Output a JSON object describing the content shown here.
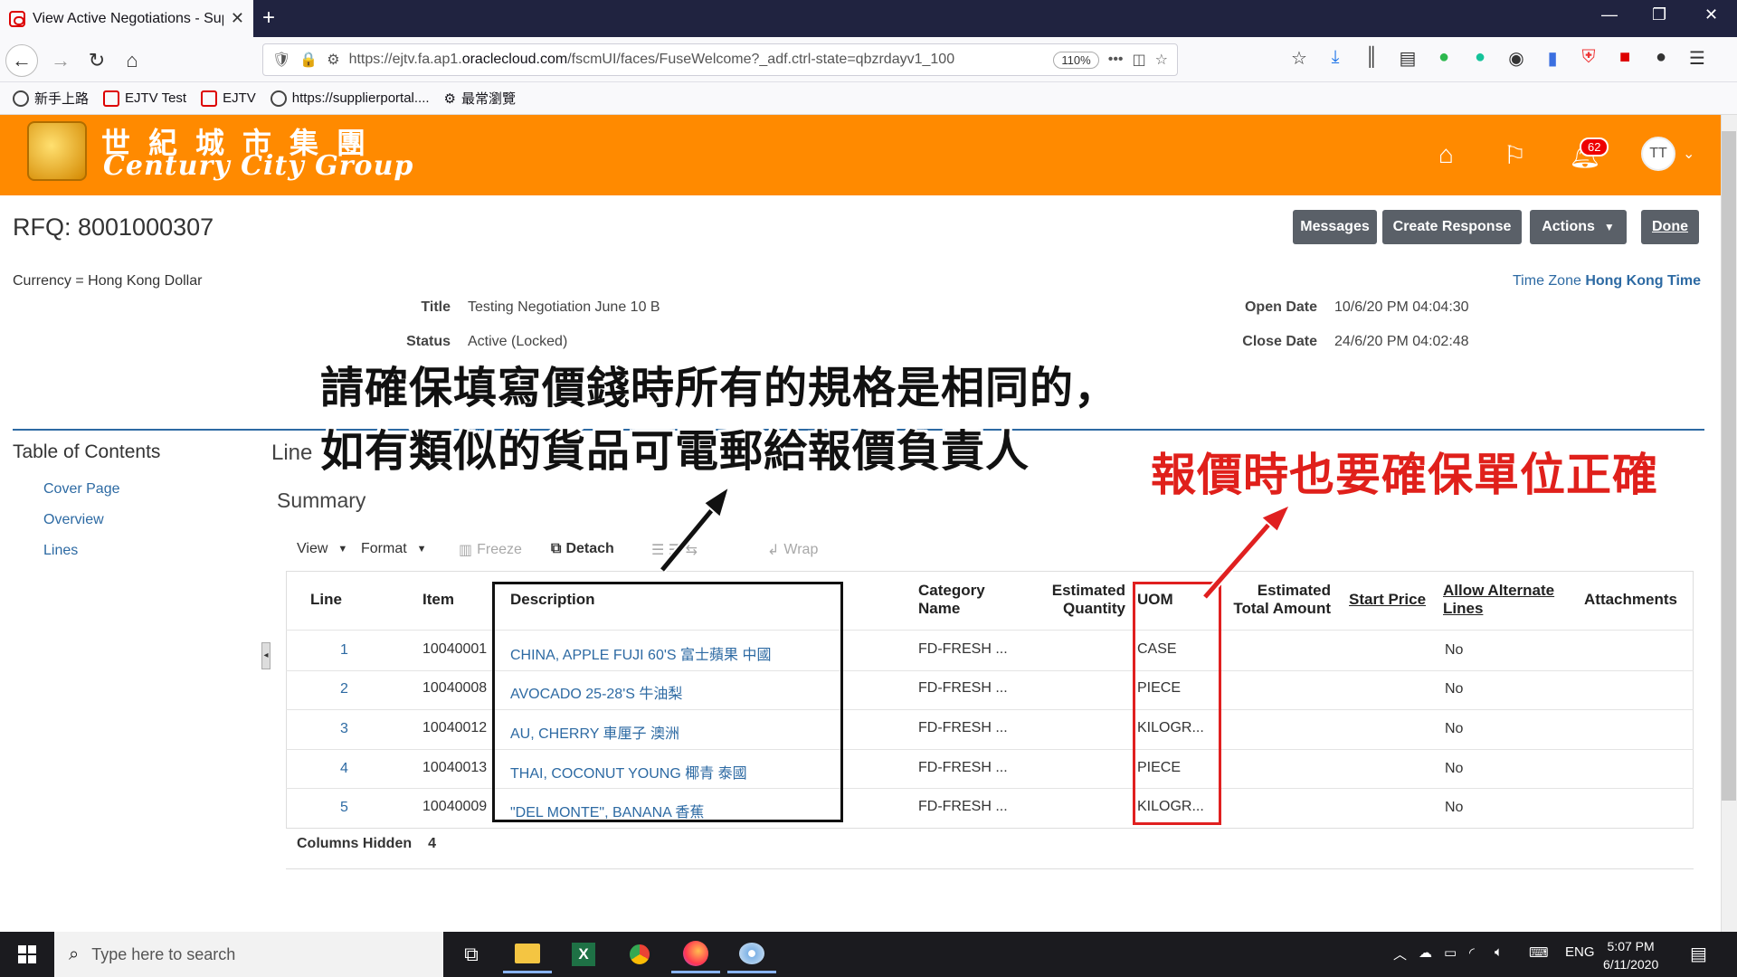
{
  "browser": {
    "tab_title": "View Active Negotiations - Sup",
    "url_prefix": "https://ejtv.fa.ap1.",
    "url_domain": "oraclecloud.com",
    "url_rest": "/fscmUI/faces/FuseWelcome?_adf.ctrl-state=qbzrdayv1_100",
    "zoom": "110%",
    "bookmarks": [
      "新手上路",
      "EJTV Test",
      "EJTV",
      "https://supplierportal....",
      "最常瀏覽"
    ]
  },
  "header": {
    "logo_cn": "世紀城市集團",
    "logo_en": "Century City Group",
    "notification_count": "62",
    "user_initials": "TT"
  },
  "page": {
    "rfq_title": "RFQ: 8001000307",
    "buttons": {
      "messages": "Messages",
      "create_response": "Create Response",
      "actions": "Actions",
      "done": "Done"
    },
    "currency": "Currency = Hong Kong Dollar",
    "timezone_label": "Time Zone",
    "timezone_value": "Hong Kong Time",
    "fields": {
      "title_label": "Title",
      "title_value": "Testing Negotiation June 10 B",
      "status_label": "Status",
      "status_value": "Active (Locked)",
      "open_label": "Open Date",
      "open_value": "10/6/20 PM 04:04:30",
      "close_label": "Close Date",
      "close_value": "24/6/20 PM 04:02:48"
    }
  },
  "toc": {
    "title": "Table of Contents",
    "links": [
      "Cover Page",
      "Overview",
      "Lines"
    ]
  },
  "lines": {
    "section_title": "Line",
    "summary_title": "Summary",
    "toolbar": {
      "view": "View",
      "format": "Format",
      "freeze": "Freeze",
      "detach": "Detach",
      "wrap": "Wrap"
    },
    "columns": {
      "line": "Line",
      "item": "Item",
      "description": "Description",
      "category_1": "Category",
      "category_2": "Name",
      "est_qty_1": "Estimated",
      "est_qty_2": "Quantity",
      "uom": "UOM",
      "est_total_1": "Estimated",
      "est_total_2": "Total Amount",
      "start_price": "Start Price",
      "allow_alt_1": "Allow Alternate",
      "allow_alt_2": "Lines",
      "attachments": "Attachments"
    },
    "rows": [
      {
        "line": "1",
        "item": "10040001",
        "description": "CHINA, APPLE FUJI 60'S 富士蘋果 中國",
        "category": "FD-FRESH ...",
        "uom": "CASE",
        "allow_alt": "No"
      },
      {
        "line": "2",
        "item": "10040008",
        "description": "AVOCADO 25-28'S 牛油梨",
        "category": "FD-FRESH ...",
        "uom": "PIECE",
        "allow_alt": "No"
      },
      {
        "line": "3",
        "item": "10040012",
        "description": "AU, CHERRY 車厘子 澳洲",
        "category": "FD-FRESH ...",
        "uom": "KILOGR...",
        "allow_alt": "No"
      },
      {
        "line": "4",
        "item": "10040013",
        "description": "THAI, COCONUT YOUNG 椰青 泰國",
        "category": "FD-FRESH ...",
        "uom": "PIECE",
        "allow_alt": "No"
      },
      {
        "line": "5",
        "item": "10040009",
        "description": "\"DEL MONTE\", BANANA 香蕉",
        "category": "FD-FRESH ...",
        "uom": "KILOGR...",
        "allow_alt": "No"
      }
    ],
    "columns_hidden_label": "Columns Hidden",
    "columns_hidden_value": "4"
  },
  "annotations": {
    "note_black_line1": "請確保填寫價錢時所有的規格是相同的，",
    "note_black_line2": "如有類似的貨品可電郵給報價負責人",
    "note_red": "報價時也要確保單位正確"
  },
  "taskbar": {
    "search_placeholder": "Type here to search",
    "lang": "ENG",
    "time": "5:07 PM",
    "date": "6/11/2020"
  },
  "colors": {
    "brand_orange": "#ff8a00",
    "link_blue": "#2d6aa3",
    "button_gray": "#5a6068",
    "annotation_red": "#e0201b"
  }
}
